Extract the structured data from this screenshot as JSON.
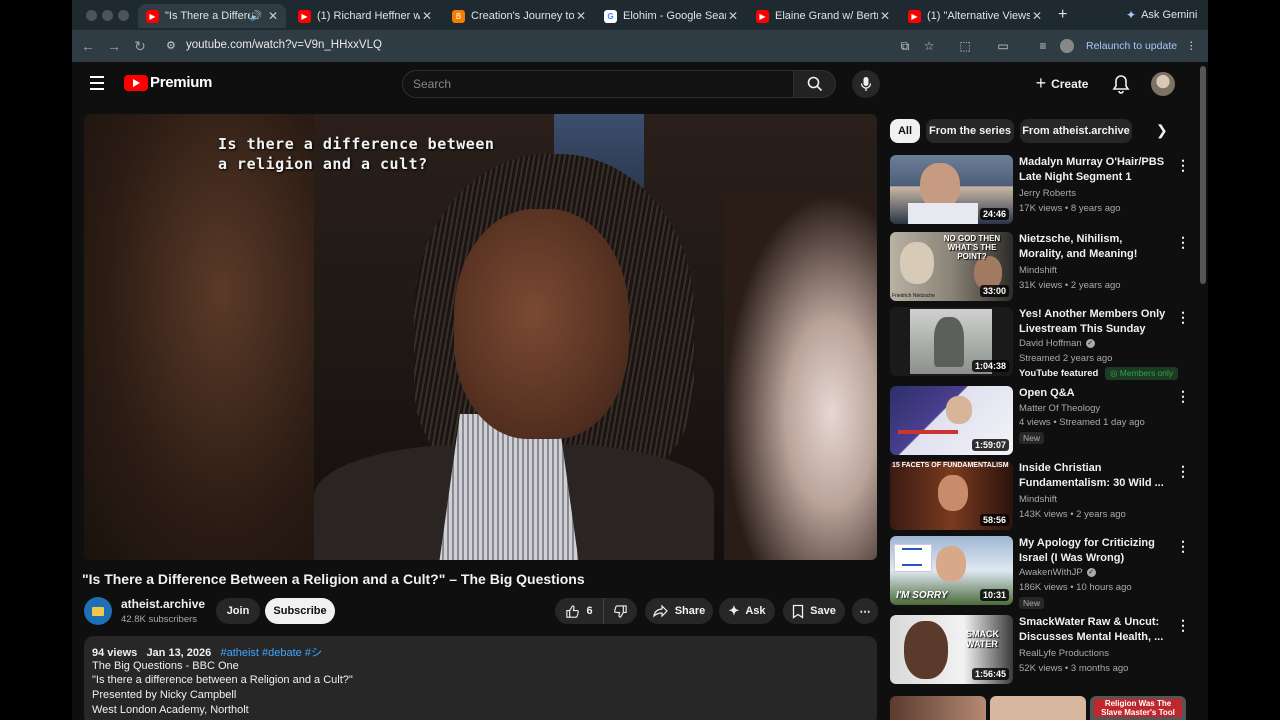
{
  "browser": {
    "tabs": [
      {
        "title": "\"Is There a Difference",
        "favicon": "youtube"
      },
      {
        "title": "(1) Richard Heffner w/ I",
        "favicon": "youtube"
      },
      {
        "title": "Creation's Journey to Li",
        "favicon": "blogger"
      },
      {
        "title": "Elohim - Google Search",
        "favicon": "google"
      },
      {
        "title": "Elaine Grand w/ Bertrand",
        "favicon": "youtube"
      },
      {
        "title": "(1) \"Alternative Views N",
        "favicon": "youtube"
      }
    ],
    "ask_gemini": "Ask Gemini",
    "url": "youtube.com/watch?v=V9n_HHxxVLQ",
    "relaunch": "Relaunch to update"
  },
  "header": {
    "logo_text": "Premium",
    "search_placeholder": "Search",
    "create_label": "Create"
  },
  "video": {
    "caption_line1": "Is there a difference between",
    "caption_line2": "a religion and a cult?",
    "title": "\"Is There a Difference Between a Religion and a Cult?\" – The Big Questions",
    "channel": "atheist.archive",
    "subscribers": "42.8K subscribers",
    "join_label": "Join",
    "subscribe_label": "Subscribe",
    "likes": "6",
    "share_label": "Share",
    "ask_label": "Ask",
    "save_label": "Save"
  },
  "description": {
    "views": "94 views",
    "date": "Jan 13, 2026",
    "tags": "#atheist #debate #シ",
    "lines": [
      "The Big Questions - BBC One",
      "\"Is there a difference between a Religion and a Cult?\"",
      "Presented by Nicky Campbell",
      "West London Academy, Northolt"
    ]
  },
  "chips": [
    "All",
    "From the series",
    "From atheist.archive"
  ],
  "recommendations": [
    {
      "title": "Madalyn Murray O'Hair/PBS Late Night Segment 1",
      "channel": "Jerry Roberts",
      "stats": "17K views • 8 years ago",
      "duration": "24:46"
    },
    {
      "title": "Nietzsche, Nihilism, Morality, and Meaning!",
      "channel": "Mindshift",
      "stats": "31K views • 2 years ago",
      "duration": "33:00",
      "thumb_text": "NO GOD THEN WHAT'S THE POINT?",
      "thumb_caption": "Friedrich Nietzsche"
    },
    {
      "title": "Yes! Another Members Only Livestream This Sunday",
      "channel": "David Hoffman",
      "stats": "Streamed 2 years ago",
      "duration": "1:04:38",
      "featured": "YouTube featured",
      "members": "Members only"
    },
    {
      "title": "Open Q&A",
      "channel": "Matter Of Theology",
      "stats": "4 views • Streamed 1 day ago",
      "duration": "1:59:07",
      "badge": "New"
    },
    {
      "title": "Inside Christian Fundamentalism: 30 Wild ...",
      "channel": "Mindshift",
      "stats": "143K views • 2 years ago",
      "duration": "58:56",
      "thumb_text": "15 FACETS OF FUNDAMENTALISM"
    },
    {
      "title": "My Apology for Criticizing Israel (I Was Wrong)",
      "channel": "AwakenWithJP",
      "stats": "186K views • 10 hours ago",
      "duration": "10:31",
      "badge": "New",
      "thumb_text": "I'M SORRY"
    },
    {
      "title": "SmackWater Raw & Uncut: Discusses Mental Health, ...",
      "channel": "RealLyfe Productions",
      "stats": "52K views • 3 months ago",
      "duration": "1:56:45",
      "thumb_text": "SMACK WATER"
    }
  ],
  "partial_thumb_text": "Religion Was The Slave Master's Tool",
  "colors": {
    "brand": "#ff0000",
    "background": "#0f0f0f",
    "link": "#3ea6ff"
  }
}
